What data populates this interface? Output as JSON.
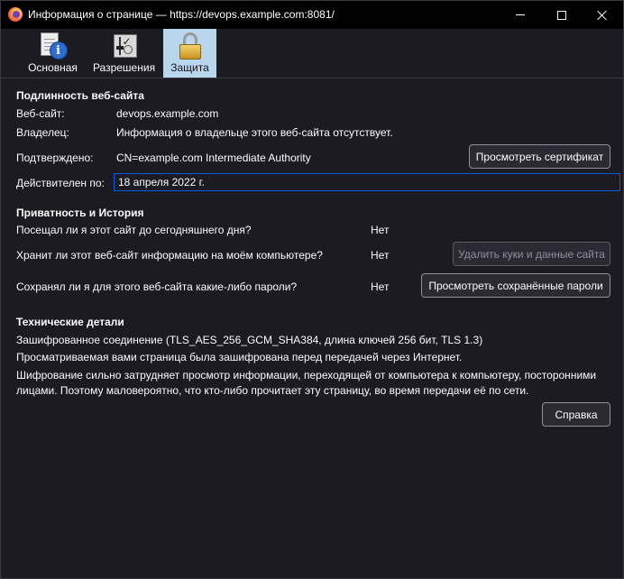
{
  "window": {
    "title": "Информация о странице — https://devops.example.com:8081/"
  },
  "tabs": [
    {
      "label": "Основная",
      "icon": "general-info-icon"
    },
    {
      "label": "Разрешения",
      "icon": "permissions-icon"
    },
    {
      "label": "Защита",
      "icon": "padlock-icon",
      "selected": true
    }
  ],
  "identity": {
    "title": "Подлинность веб-сайта",
    "website_label": "Веб-сайт:",
    "website_value": "devops.example.com",
    "owner_label": "Владелец:",
    "owner_value": "Информация о владельце этого веб-сайта отсутствует.",
    "verified_label": "Подтверждено:",
    "verified_value": "CN=example.com Intermediate Authority",
    "view_cert_button": "Просмотреть сертификат",
    "expires_label": "Действителен по:",
    "expires_value": "18 апреля 2022 г."
  },
  "privacy": {
    "title": "Приватность и История",
    "visited_question": "Посещал ли я этот сайт до сегодняшнего дня?",
    "visited_answer": "Нет",
    "cookies_question": "Хранит ли этот веб-сайт информацию на моём компьютере?",
    "cookies_answer": "Нет",
    "clear_cookies_button": "Удалить куки и данные сайта",
    "passwords_question": "Сохранял ли я для этого веб-сайта какие-либо пароли?",
    "passwords_answer": "Нет",
    "view_passwords_button": "Просмотреть сохранённые пароли"
  },
  "technical": {
    "title": "Технические детали",
    "line1": "Зашифрованное соединение (TLS_AES_256_GCM_SHA384, длина ключей 256 бит, TLS 1.3)",
    "line2": "Просматриваемая вами страница была зашифрована перед передачей через Интернет.",
    "line3": "Шифрование сильно затрудняет просмотр информации, переходящей от компьютера к компьютеру, посторонними",
    "line4": "лицами. Поэтому маловероятно, что кто-либо прочитает эту страницу, во время передачи её по сети."
  },
  "help_button": "Справка",
  "colors": {
    "background": "#1c1b22",
    "titlebar": "#000000",
    "selected_tab": "#b8d7ee",
    "focus_border": "#0060df"
  }
}
